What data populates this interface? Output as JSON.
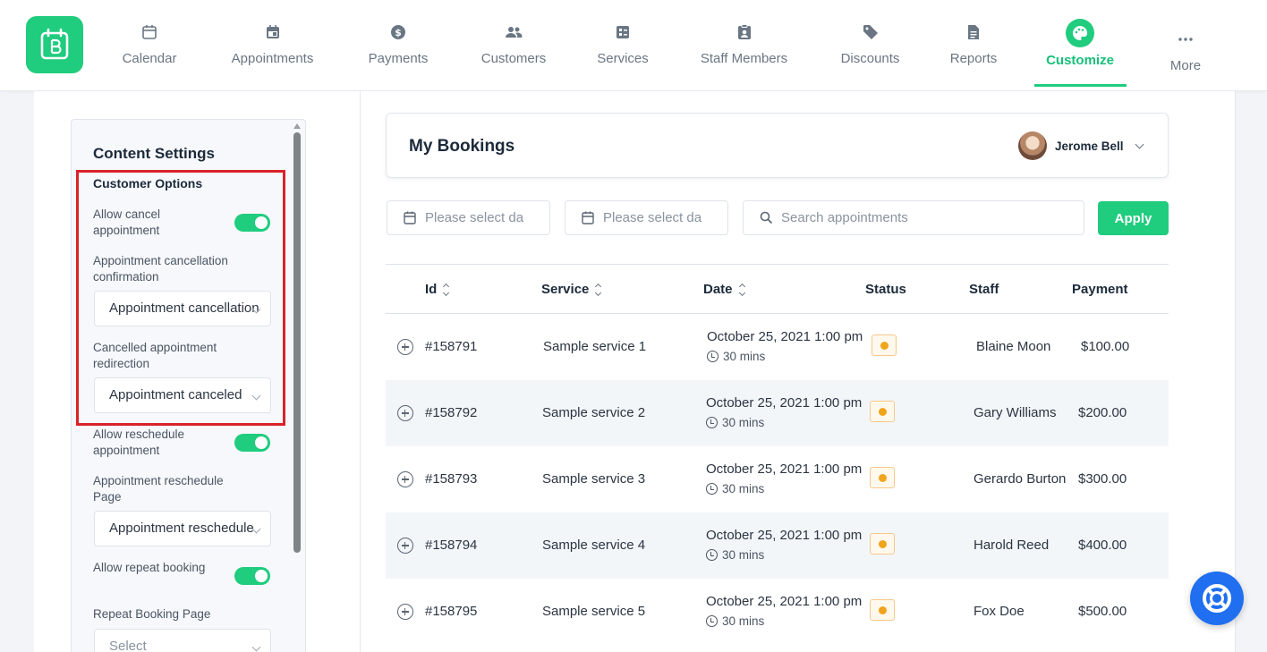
{
  "nav": {
    "items": [
      {
        "label": "Calendar",
        "icon": "calendar-icon"
      },
      {
        "label": "Appointments",
        "icon": "calendar-check-icon"
      },
      {
        "label": "Payments",
        "icon": "dollar-icon"
      },
      {
        "label": "Customers",
        "icon": "users-icon"
      },
      {
        "label": "Services",
        "icon": "services-icon"
      },
      {
        "label": "Staff Members",
        "icon": "badge-icon"
      },
      {
        "label": "Discounts",
        "icon": "tag-icon"
      },
      {
        "label": "Reports",
        "icon": "report-icon"
      },
      {
        "label": "Customize",
        "icon": "palette-icon",
        "active": true
      },
      {
        "label": "More",
        "icon": "more-icon"
      }
    ],
    "accent_color": "#20cc7e"
  },
  "settings": {
    "title": "Content Settings",
    "section": "Customer Options",
    "allow_cancel_label": "Allow cancel appointment",
    "allow_cancel_on": true,
    "cancel_confirm_label": "Appointment cancellation confirmation",
    "cancel_confirm_value": "Appointment cancellation",
    "cancel_redirect_label": "Cancelled appointment redirection",
    "cancel_redirect_value": "Appointment canceled",
    "allow_reschedule_label": "Allow reschedule appointment",
    "allow_reschedule_on": true,
    "reschedule_page_label": "Appointment reschedule Page",
    "reschedule_page_value": "Appointment reschedule",
    "allow_repeat_label": "Allow repeat booking",
    "allow_repeat_on": true,
    "repeat_page_label": "Repeat Booking Page",
    "repeat_page_value": "Select",
    "highlight_color": "#d9232a"
  },
  "bookings": {
    "title": "My Bookings",
    "user_name": "Jerome Bell",
    "date_from_placeholder": "Please select date",
    "date_to_placeholder": "Please select date",
    "search_placeholder": "Search appointments",
    "apply_label": "Apply",
    "columns": [
      "Id",
      "Service",
      "Date",
      "Status",
      "Staff",
      "Payment"
    ],
    "rows": [
      {
        "id": "#158791",
        "service": "Sample service 1",
        "date": "October 25, 2021 1:00 pm",
        "duration": "30 mins",
        "status": "pending",
        "staff": "Blaine Moon",
        "payment": "$100.00"
      },
      {
        "id": "#158792",
        "service": "Sample service 2",
        "date": "October 25, 2021 1:00 pm",
        "duration": "30 mins",
        "status": "pending",
        "staff": "Gary Williams",
        "payment": "$200.00"
      },
      {
        "id": "#158793",
        "service": "Sample service 3",
        "date": "October 25, 2021 1:00 pm",
        "duration": "30 mins",
        "status": "pending",
        "staff": "Gerardo Burton",
        "payment": "$300.00"
      },
      {
        "id": "#158794",
        "service": "Sample service 4",
        "date": "October 25, 2021 1:00 pm",
        "duration": "30 mins",
        "status": "pending",
        "staff": "Harold Reed",
        "payment": "$400.00"
      },
      {
        "id": "#158795",
        "service": "Sample service 5",
        "date": "October 25, 2021 1:00 pm",
        "duration": "30 mins",
        "status": "pending",
        "staff": "Fox Doe",
        "payment": "$500.00"
      }
    ]
  },
  "help": {
    "icon": "lifebuoy-icon",
    "color": "#1f6ff0"
  }
}
